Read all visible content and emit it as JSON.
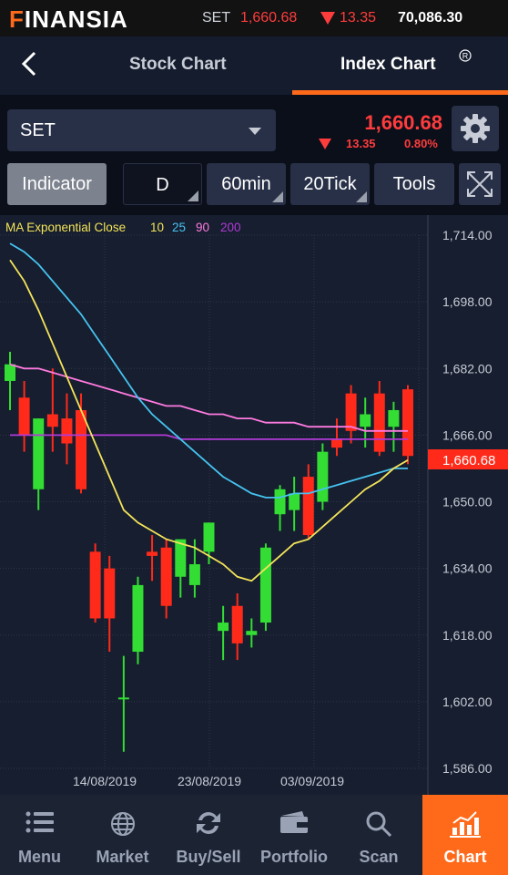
{
  "app": {
    "logo": "FINANSIA"
  },
  "ticker": {
    "symbol": "SET",
    "price": "1,660.68",
    "change": "13.35",
    "value": "70,086.30"
  },
  "nav": {
    "back": "‹",
    "tabs": [
      {
        "label": "Stock Chart"
      },
      {
        "label": "Index Chart"
      }
    ],
    "active_tab": "Index Chart"
  },
  "selector": {
    "value": "SET"
  },
  "quote": {
    "price": "1,660.68",
    "change": "13.35",
    "percent": "0.80%"
  },
  "toolbar": {
    "indicator": "Indicator",
    "d": "D",
    "m60": "60min",
    "tick20": "20Tick",
    "tools": "Tools"
  },
  "legend": {
    "name": "MA Exponential Close",
    "p1": "10",
    "p2": "25",
    "p3": "90",
    "p4": "200"
  },
  "colors": {
    "accent": "#ff6a1a",
    "up": "#33dd33",
    "down": "#ff2a1a",
    "ma10": "#f4e45a",
    "ma25": "#46c3f0",
    "ma90": "#ff7ae0",
    "ma200": "#b23ad8"
  },
  "chart_data": {
    "type": "candlestick",
    "ylim": [
      1586,
      1714
    ],
    "yticks": [
      "1,714.00",
      "1,698.00",
      "1,682.00",
      "1,666.00",
      "1,650.00",
      "1,634.00",
      "1,618.00",
      "1,602.00",
      "1,586.00"
    ],
    "xlabels": [
      "14/08/2019",
      "23/08/2019",
      "03/09/2019"
    ],
    "last_price_label": "1,660.68",
    "candles": [
      {
        "o": 1679,
        "h": 1686,
        "l": 1672,
        "c": 1683
      },
      {
        "o": 1675,
        "h": 1679,
        "l": 1662,
        "c": 1666
      },
      {
        "o": 1653,
        "h": 1670,
        "l": 1648,
        "c": 1670
      },
      {
        "o": 1671,
        "h": 1682,
        "l": 1662,
        "c": 1668
      },
      {
        "o": 1670,
        "h": 1676,
        "l": 1659,
        "c": 1664
      },
      {
        "o": 1672,
        "h": 1676,
        "l": 1652,
        "c": 1653
      },
      {
        "o": 1638,
        "h": 1640,
        "l": 1621,
        "c": 1622
      },
      {
        "o": 1634,
        "h": 1637,
        "l": 1614,
        "c": 1622
      },
      {
        "o": 1603,
        "h": 1613,
        "l": 1590,
        "c": 1603
      },
      {
        "o": 1614,
        "h": 1632,
        "l": 1611,
        "c": 1630
      },
      {
        "o": 1638,
        "h": 1642,
        "l": 1631,
        "c": 1637
      },
      {
        "o": 1639,
        "h": 1641,
        "l": 1622,
        "c": 1625
      },
      {
        "o": 1632,
        "h": 1640,
        "l": 1627,
        "c": 1641
      },
      {
        "o": 1630,
        "h": 1641,
        "l": 1627,
        "c": 1635
      },
      {
        "o": 1638,
        "h": 1645,
        "l": 1635,
        "c": 1645
      },
      {
        "o": 1619,
        "h": 1625,
        "l": 1612,
        "c": 1621
      },
      {
        "o": 1625,
        "h": 1628,
        "l": 1612,
        "c": 1616
      },
      {
        "o": 1618,
        "h": 1622,
        "l": 1615,
        "c": 1619
      },
      {
        "o": 1621,
        "h": 1640,
        "l": 1619,
        "c": 1639
      },
      {
        "o": 1647,
        "h": 1654,
        "l": 1643,
        "c": 1653
      },
      {
        "o": 1648,
        "h": 1656,
        "l": 1643,
        "c": 1652
      },
      {
        "o": 1656,
        "h": 1659,
        "l": 1641,
        "c": 1642
      },
      {
        "o": 1650,
        "h": 1664,
        "l": 1648,
        "c": 1662
      },
      {
        "o": 1665,
        "h": 1670,
        "l": 1661,
        "c": 1663
      },
      {
        "o": 1676,
        "h": 1678,
        "l": 1664,
        "c": 1667
      },
      {
        "o": 1668,
        "h": 1675,
        "l": 1663,
        "c": 1671
      },
      {
        "o": 1676,
        "h": 1679,
        "l": 1661,
        "c": 1662
      },
      {
        "o": 1668,
        "h": 1674,
        "l": 1662,
        "c": 1672
      },
      {
        "o": 1677,
        "h": 1678,
        "l": 1659,
        "c": 1661
      }
    ],
    "ma10": [
      1708,
      1703,
      1696,
      1688,
      1680,
      1672,
      1664,
      1656,
      1648,
      1645,
      1643,
      1641,
      1640,
      1639,
      1637,
      1635,
      1632,
      1631,
      1634,
      1637,
      1640,
      1641,
      1644,
      1647,
      1650,
      1653,
      1655,
      1658,
      1660
    ],
    "ma25": [
      1712,
      1710,
      1707,
      1703,
      1699,
      1695,
      1690,
      1685,
      1680,
      1675,
      1671,
      1668,
      1665,
      1662,
      1659,
      1656,
      1654,
      1652,
      1651,
      1651,
      1652,
      1652,
      1653,
      1654,
      1655,
      1656,
      1657,
      1658,
      1658
    ],
    "ma90": [
      1683,
      1682,
      1682,
      1681,
      1680,
      1679,
      1678,
      1677,
      1676,
      1675,
      1674,
      1673,
      1673,
      1672,
      1671,
      1671,
      1670,
      1670,
      1669,
      1669,
      1669,
      1668,
      1668,
      1668,
      1668,
      1667,
      1667,
      1667,
      1667
    ],
    "ma200": [
      1666,
      1666,
      1666,
      1666,
      1666,
      1666,
      1666,
      1666,
      1666,
      1666,
      1666,
      1666,
      1665,
      1665,
      1665,
      1665,
      1665,
      1665,
      1665,
      1665,
      1665,
      1665,
      1665,
      1665,
      1665,
      1665,
      1665,
      1665,
      1665
    ]
  },
  "bottom_nav": [
    {
      "label": "Menu",
      "icon": "menu-icon"
    },
    {
      "label": "Market",
      "icon": "globe-icon"
    },
    {
      "label": "Buy/Sell",
      "icon": "exchange-icon"
    },
    {
      "label": "Portfolio",
      "icon": "wallet-icon"
    },
    {
      "label": "Scan",
      "icon": "search-icon"
    },
    {
      "label": "Chart",
      "icon": "chart-icon"
    }
  ],
  "active_nav": "Chart"
}
